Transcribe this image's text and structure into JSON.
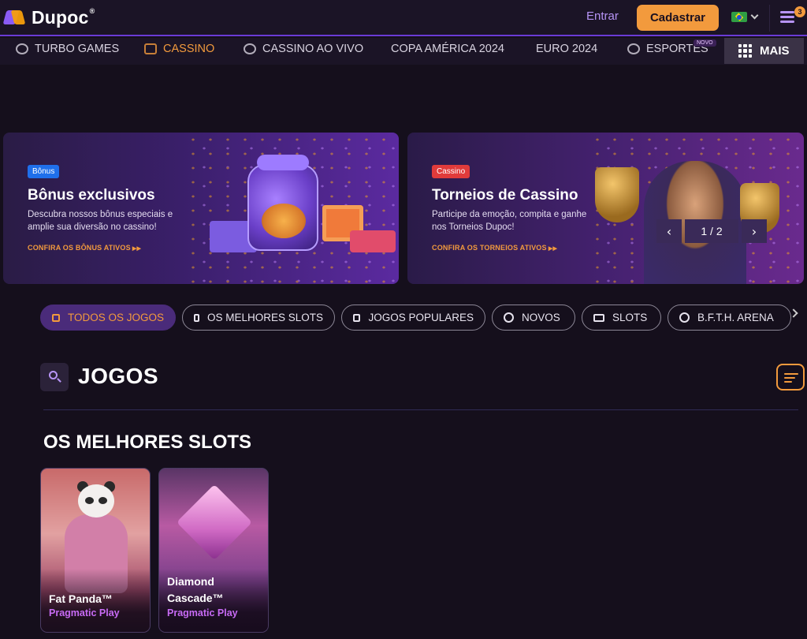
{
  "header": {
    "logo_text": "Dupoc",
    "logo_mark": "®",
    "login_label": "Entrar",
    "signup_label": "Cadastrar",
    "menu_badge": "3"
  },
  "nav": {
    "items": [
      {
        "label": "TURBO GAMES",
        "icon": "turbo-icon"
      },
      {
        "label": "CASSINO",
        "icon": "slot-icon"
      },
      {
        "label": "CASSINO AO VIVO",
        "icon": "dealer-icon"
      },
      {
        "label": "COPA AMÉRICA 2024"
      },
      {
        "label": "EURO 2024"
      },
      {
        "label": "ESPORTES",
        "icon": "soccer-ball-icon",
        "badge": "NOVO"
      }
    ],
    "more_label": "MAIS"
  },
  "banners": [
    {
      "tag": "Bônus",
      "title": "Bônus exclusivos",
      "description": "Descubra nossos bônus especiais e amplie sua diversão no cassino!",
      "link": "CONFIRA OS BÔNUS ATIVOS"
    },
    {
      "tag": "Cassino",
      "title": "Torneios de Cassino",
      "description": "Participe da emoção, compita e ganhe nos Torneios Dupoc!",
      "link": "CONFIRA OS TORNEIOS ATIVOS"
    }
  ],
  "carousel": {
    "counter": "1 / 2",
    "prev": "‹",
    "next": "›"
  },
  "filters": [
    {
      "label": "TODOS OS JOGOS",
      "active": true
    },
    {
      "label": "OS MELHORES SLOTS"
    },
    {
      "label": "JOGOS POPULARES"
    },
    {
      "label": "NOVOS"
    },
    {
      "label": "SLOTS"
    },
    {
      "label": "B.F.T.H. ARENA"
    }
  ],
  "games_section": {
    "title": "JOGOS",
    "subsection_title": "OS MELHORES SLOTS"
  },
  "games": [
    {
      "name": "Fat Panda™",
      "provider": "Pragmatic Play"
    },
    {
      "name": "Diamond Cascade™",
      "provider": "Pragmatic Play"
    }
  ],
  "colors": {
    "accent": "#f29a3d",
    "purple": "#b794f6",
    "background": "#150f1c"
  }
}
